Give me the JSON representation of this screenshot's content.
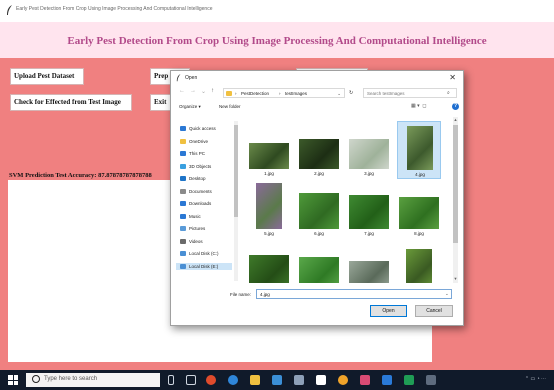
{
  "app": {
    "window_title": "Early Pest Detection From Crop Using Image Processing And Computational Intelligence",
    "heading": "Early Pest Detection From Crop Using Image Processing And Computational Intelligence",
    "buttons": {
      "upload": "Upload Pest Dataset",
      "check": "Check for Effected from Test Image",
      "preprocess": "Prep",
      "exit": "Exit"
    },
    "accuracy_text": "SVM Prediction Test Accuracy: 87.87878787878788"
  },
  "dialog": {
    "title": "Open",
    "breadcrumb": [
      "PestDetection",
      "testImages"
    ],
    "search_placeholder": "Search testImages",
    "organize_label": "Organize ▾",
    "new_folder_label": "New folder",
    "nav_items": [
      {
        "label": "Quick access",
        "icon": "star-icon",
        "color": "#2b78d4"
      },
      {
        "label": "OneDrive",
        "icon": "cloud-icon",
        "color": "#f0c040"
      },
      {
        "label": "This PC",
        "icon": "computer-icon",
        "color": "#2b78d4"
      },
      {
        "label": "3D Objects",
        "icon": "cube-icon",
        "color": "#3aa0e0"
      },
      {
        "label": "Desktop",
        "icon": "desktop-icon",
        "color": "#1e74c8"
      },
      {
        "label": "Documents",
        "icon": "document-icon",
        "color": "#8a8a8a"
      },
      {
        "label": "Downloads",
        "icon": "download-icon",
        "color": "#2b78d4"
      },
      {
        "label": "Music",
        "icon": "music-icon",
        "color": "#2b78d4"
      },
      {
        "label": "Pictures",
        "icon": "picture-icon",
        "color": "#5a9bd8"
      },
      {
        "label": "Videos",
        "icon": "video-icon",
        "color": "#6a6a6a"
      },
      {
        "label": "Local Disk (C:)",
        "icon": "drive-icon",
        "color": "#4a8fd4"
      },
      {
        "label": "Local Disk (E:)",
        "icon": "drive-icon",
        "color": "#4a8fd4"
      }
    ],
    "selected_nav": "Local Disk (E:)",
    "files": [
      "1.jpg",
      "2.jpg",
      "3.jpg",
      "4.jpg",
      "5.jpg",
      "6.jpg",
      "7.jpg",
      "8.jpg",
      "",
      "",
      "",
      ""
    ],
    "selected_file": "4.jpg",
    "file_name_label": "File name:",
    "file_name_value": "4.jpg",
    "open_label": "Open",
    "cancel_label": "Cancel"
  },
  "taskbar": {
    "search_placeholder": "Type here to search",
    "colors": {
      "accent": "#0078d7",
      "window_bg": "#f08080"
    }
  }
}
